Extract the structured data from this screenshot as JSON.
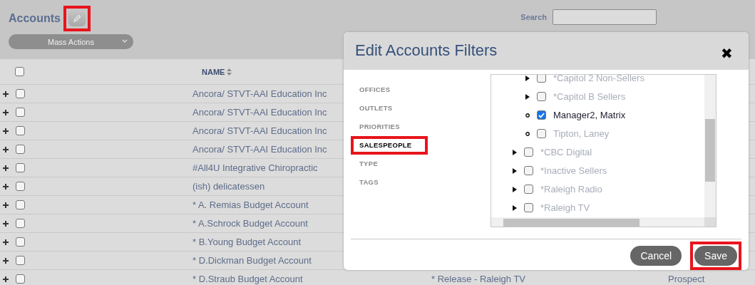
{
  "header": {
    "title": "Accounts",
    "edit_button": {
      "highlighted": true
    },
    "mass_actions": "Mass Actions",
    "search": {
      "label": "Search"
    }
  },
  "table": {
    "select_all_checked": false,
    "columns": [
      {
        "label": "NAME",
        "sorted": true
      }
    ],
    "rows": [
      {
        "name": "Ancora/ STVT-AAI Education Inc",
        "checked": false
      },
      {
        "name": "Ancora/ STVT-AAI Education Inc",
        "checked": false
      },
      {
        "name": "Ancora/ STVT-AAI Education Inc",
        "checked": false
      },
      {
        "name": "Ancora/ STVT-AAI Education Inc",
        "checked": false
      },
      {
        "name": "#All4U Integrative Chiropractic",
        "checked": false
      },
      {
        "name": "(ish) delicatessen",
        "checked": false
      },
      {
        "name": "* A. Remias Budget Account",
        "checked": false
      },
      {
        "name": "* A.Schrock Budget Account",
        "checked": false
      },
      {
        "name": "* B.Young Budget Account",
        "checked": false
      },
      {
        "name": "* D.Dickman Budget Account",
        "checked": false
      },
      {
        "name": "* D.Straub Budget Account",
        "checked": false,
        "column_2": "* Release - Raleigh TV",
        "column_3": "Prospect"
      }
    ]
  },
  "dialog": {
    "title": "Edit Accounts Filters",
    "close": "✖",
    "nav": [
      {
        "label": "OFFICES",
        "selected": false,
        "highlighted": false
      },
      {
        "label": "OUTLETS",
        "selected": false,
        "highlighted": false
      },
      {
        "label": "PRIORITIES",
        "selected": false,
        "highlighted": false
      },
      {
        "label": "SALESPEOPLE",
        "selected": true,
        "highlighted": true
      },
      {
        "label": "TYPE",
        "selected": false,
        "highlighted": false
      },
      {
        "label": "TAGS",
        "selected": false,
        "highlighted": false
      }
    ],
    "tree": [
      {
        "children": [
          {
            "label": "*Capitol 2 Non-Sellers",
            "kind": "branch",
            "checked": false
          },
          {
            "label": "*Capitol B Sellers",
            "kind": "branch",
            "checked": false
          },
          {
            "label": "Manager2, Matrix",
            "kind": "leaf",
            "checked": true
          },
          {
            "label": "Tipton, Laney",
            "kind": "leaf",
            "checked": false
          }
        ]
      },
      {
        "label": "*CBC Digital",
        "kind": "branch",
        "checked": false
      },
      {
        "label": "*Inactive Sellers",
        "kind": "branch",
        "checked": false
      },
      {
        "label": "*Raleigh Radio",
        "kind": "branch",
        "checked": false
      },
      {
        "label": "*Raleigh TV",
        "kind": "branch",
        "checked": false
      }
    ],
    "buttons": [
      {
        "label": "Cancel",
        "highlighted": false
      },
      {
        "label": "Save",
        "highlighted": true
      }
    ]
  }
}
